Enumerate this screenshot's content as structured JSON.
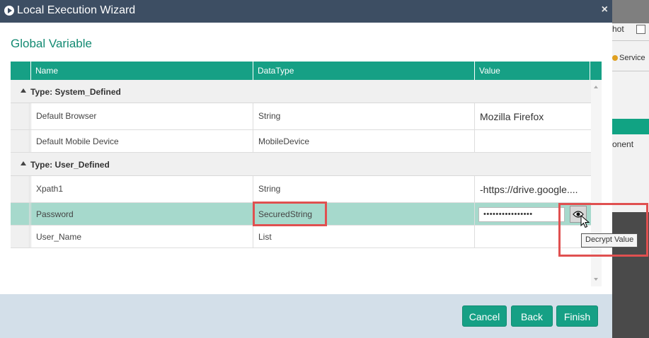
{
  "dialog": {
    "title": "Local Execution Wizard",
    "close_glyph": "×",
    "section_title": "Global Variable"
  },
  "grid": {
    "columns": [
      "Name",
      "DataType",
      "Value"
    ],
    "groups": [
      {
        "label": "Type: System_Defined",
        "rows": [
          {
            "name": "Default Browser",
            "datatype": "String",
            "value": "Mozilla Firefox"
          },
          {
            "name": "Default Mobile Device",
            "datatype": "MobileDevice",
            "value": ""
          }
        ]
      },
      {
        "label": "Type: User_Defined",
        "rows": [
          {
            "name": "Xpath1",
            "datatype": "String",
            "value": "-https://drive.google...."
          },
          {
            "name": "Password",
            "datatype": "SecuredString",
            "value": "••••••••••••••••"
          },
          {
            "name": "User_Name",
            "datatype": "List",
            "value": ""
          }
        ]
      }
    ],
    "selected_row": "Password"
  },
  "tooltip": "Decrypt Value",
  "footer": {
    "cancel_label": "Cancel",
    "back_label": "Back",
    "finish_label": "Finish"
  },
  "background_app": {
    "fragment_1": "hot",
    "fragment_2": "Service",
    "fragment_3": "onent"
  },
  "colors": {
    "titlebar": "#3d4e63",
    "accent": "#16a085",
    "selected_row": "#a6d9cc",
    "highlight_box": "#e05050",
    "footer": "#d3dfe9"
  },
  "icons": {
    "title": "play-circle-icon",
    "decrypt": "eye-icon",
    "group_toggle": "collapse-triangle-icon"
  }
}
